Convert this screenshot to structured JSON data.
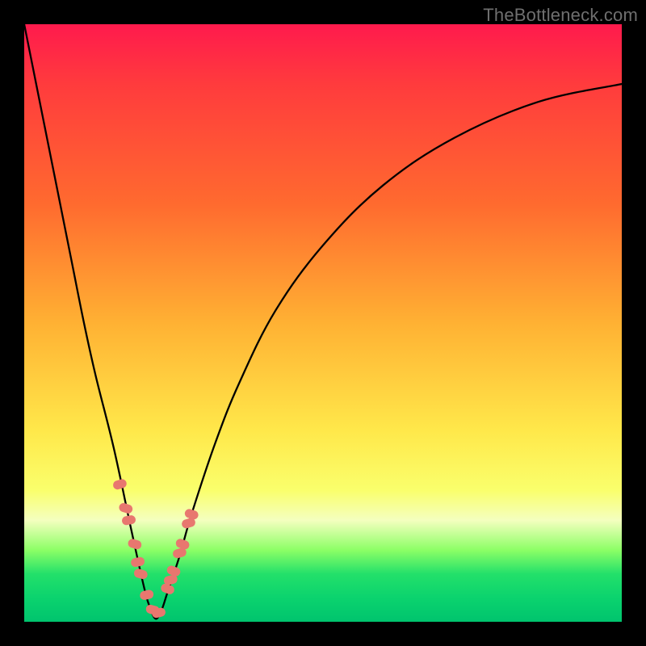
{
  "watermark": "TheBottleneck.com",
  "colors": {
    "frame": "#000000",
    "curve_stroke": "#000000",
    "marker_fill": "#e8776f",
    "gradient_stops": [
      "#ff1a4d",
      "#ff3b3d",
      "#ff6a2f",
      "#ffb133",
      "#ffe84a",
      "#faff6c",
      "#f4ffbf",
      "#8cff66",
      "#23e06a",
      "#0bd36e",
      "#00c46e"
    ]
  },
  "chart_data": {
    "type": "line",
    "title": "",
    "xlabel": "",
    "ylabel": "",
    "xlim": [
      0,
      100
    ],
    "ylim": [
      0,
      100
    ],
    "note": "V-shaped bottleneck curve; y is mismatch (0 = ideal, 100 = worst). Minimum near x ≈ 22.",
    "series": [
      {
        "name": "bottleneck-curve",
        "x": [
          0,
          2,
          4,
          6,
          8,
          10,
          12,
          15,
          18,
          20,
          21,
          22,
          23,
          24,
          26,
          28,
          32,
          36,
          42,
          50,
          60,
          72,
          86,
          100
        ],
        "y": [
          100,
          90,
          80,
          70,
          60,
          50,
          41,
          29,
          15,
          6,
          2.5,
          0.5,
          2,
          5,
          11,
          18,
          30,
          40,
          52,
          63,
          73,
          81,
          87,
          90
        ]
      }
    ],
    "markers": {
      "name": "highlighted-points",
      "x": [
        16,
        17,
        17.5,
        18.5,
        19,
        19.5,
        20.5,
        21.5,
        22.5,
        24,
        24.5,
        25,
        26,
        26.5,
        27.5,
        28
      ],
      "y": [
        23,
        19,
        17,
        13,
        10,
        8,
        4.5,
        2,
        1.5,
        5.5,
        7,
        8.5,
        11.5,
        13,
        16.5,
        18
      ]
    }
  }
}
